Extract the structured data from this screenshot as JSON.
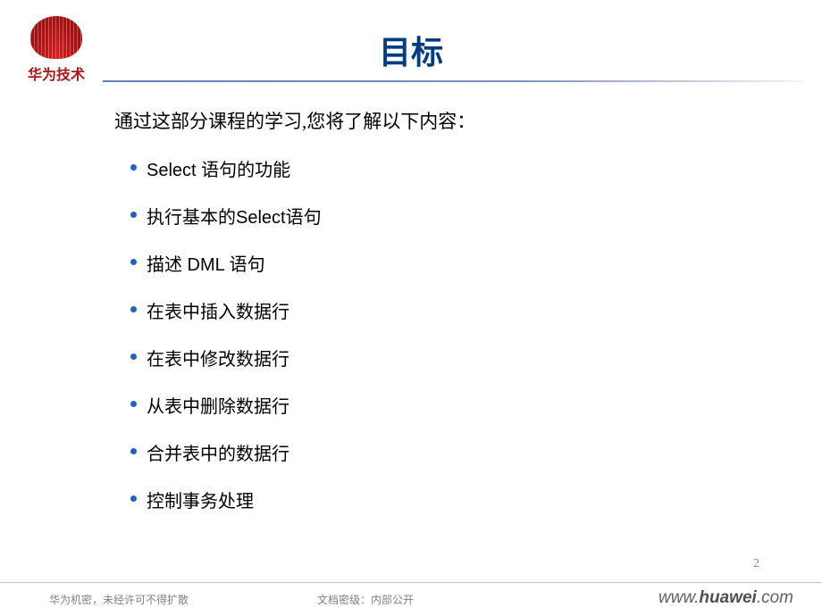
{
  "logo": {
    "text": "华为技术"
  },
  "title": "目标",
  "intro": "通过这部分课程的学习,您将了解以下内容：",
  "bullets": [
    "Select 语句的功能",
    "执行基本的Select语句",
    "描述 DML 语句",
    "在表中插入数据行",
    "在表中修改数据行",
    "从表中删除数据行",
    "合并表中的数据行",
    "控制事务处理"
  ],
  "page_number": "2",
  "footer": {
    "left": "华为机密，未经许可不得扩散",
    "center": "文档密级：内部公开",
    "url_prefix": "www.",
    "url_brand": "huawei",
    "url_suffix": ".com"
  }
}
